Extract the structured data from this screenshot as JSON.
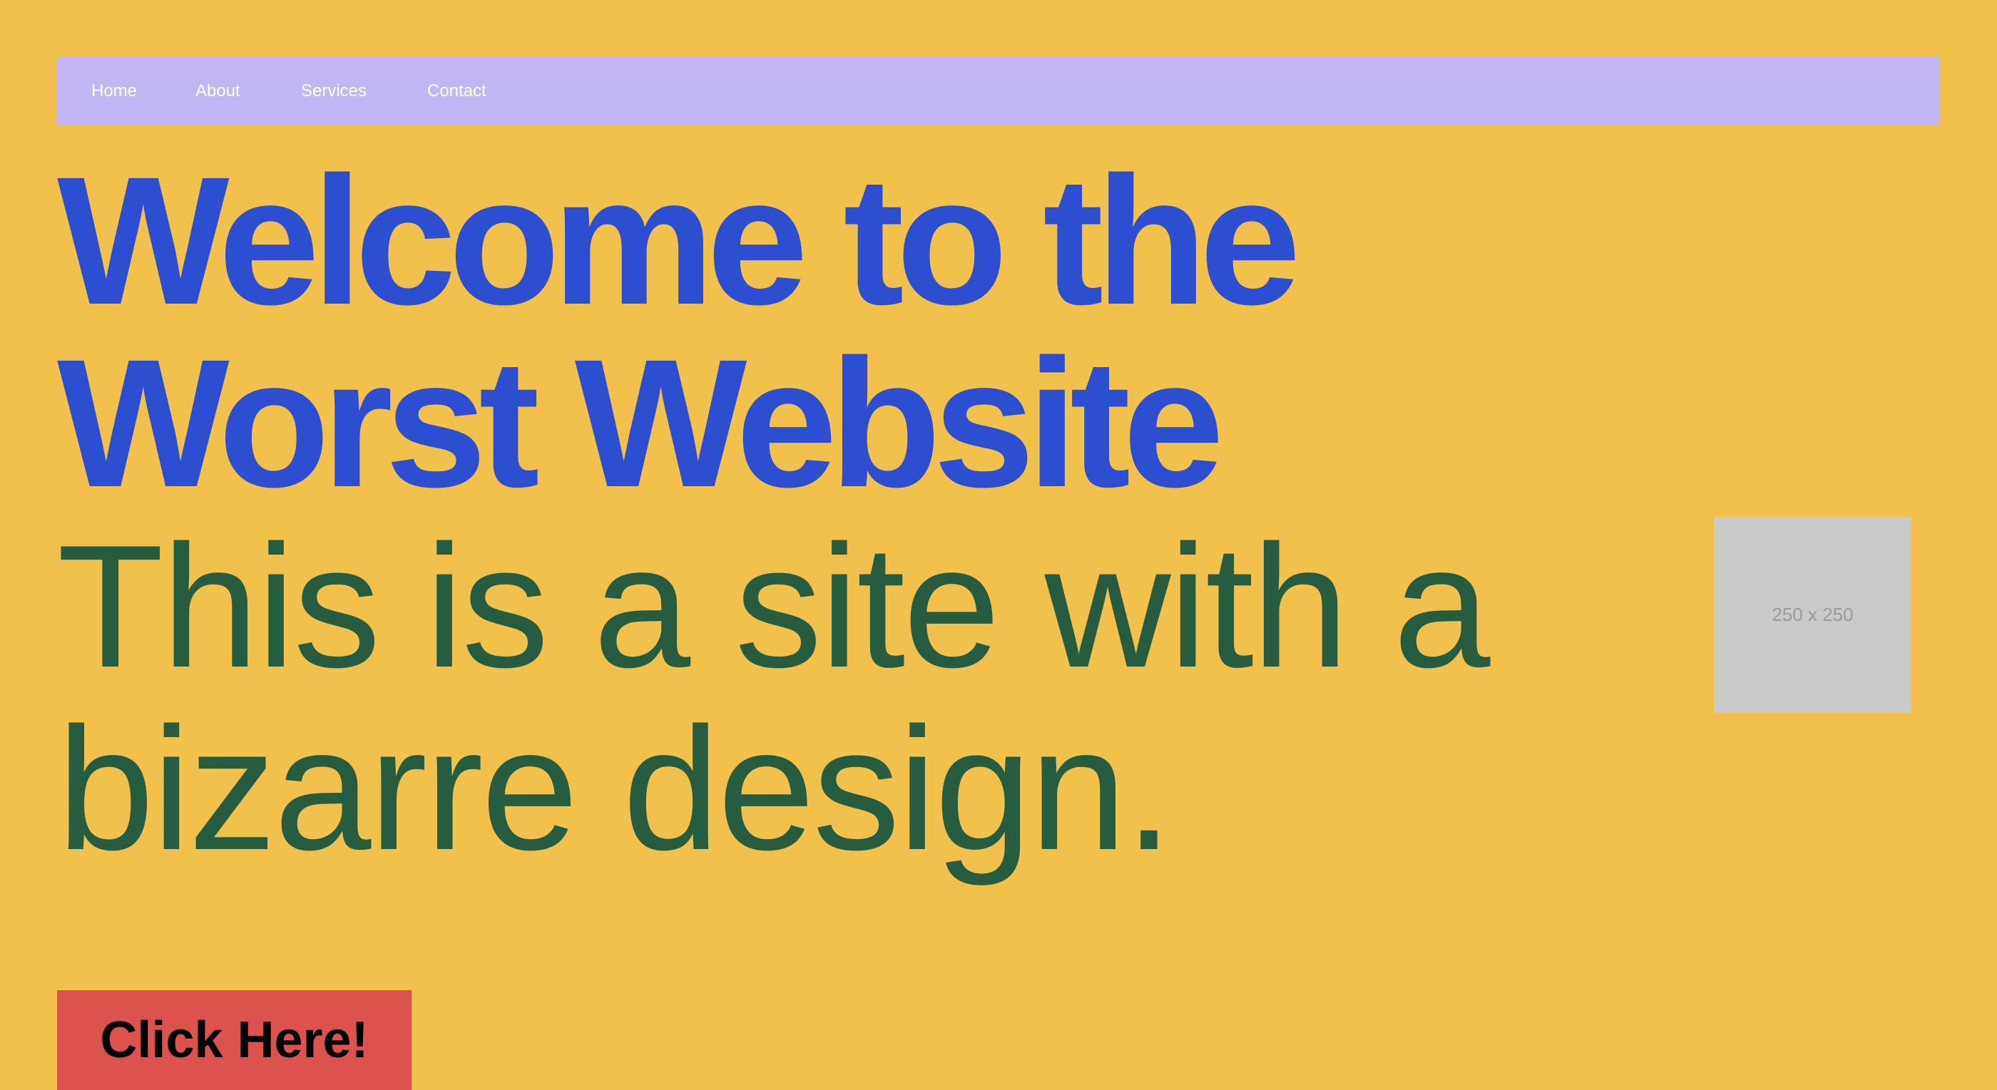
{
  "theme": {
    "page_background": "#F2C14B",
    "nav_background": "#C2B6F7",
    "nav_text": "#FFFFFF",
    "title_color": "#2C4FD1",
    "subtitle_color": "#265D41",
    "placeholder_background": "#CACACA",
    "placeholder_text": "#9B9B9B",
    "button_background": "#DC524D"
  },
  "nav": {
    "items": [
      {
        "label": "Home"
      },
      {
        "label": "About"
      },
      {
        "label": "Services"
      },
      {
        "label": "Contact"
      }
    ]
  },
  "hero": {
    "title_line1": "Welcome to the",
    "title_line2": "Worst Website",
    "subtitle_line1": "This is a site with a",
    "subtitle_line2": "bizarre design.",
    "image_placeholder": "250 x 250",
    "button_label": "Click Here!"
  }
}
